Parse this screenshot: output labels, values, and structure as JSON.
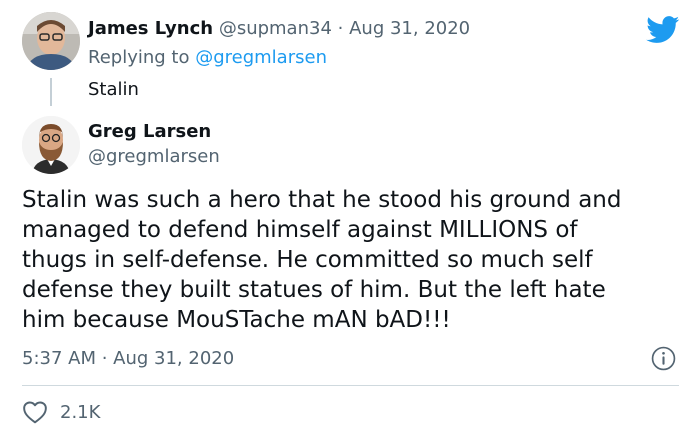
{
  "reply": {
    "display_name": "James Lynch",
    "handle": "@supman34",
    "separator": "·",
    "date": "Aug 31, 2020",
    "replying_label": "Replying to",
    "replying_to": "@gregmlarsen",
    "text": "Stalin"
  },
  "tweet": {
    "display_name": "Greg Larsen",
    "handle": "@gregmlarsen",
    "text": "Stalin was such a hero that he stood his ground and\nmanaged to defend himself against MILLIONS of\nthugs in self-defense. He committed so much self\ndefense they built statues of him. But the left hate\nhim because MouSTache mAN bAD!!!",
    "timestamp": "5:37 AM · Aug 31, 2020",
    "like_count": "2.1K"
  },
  "icons": {
    "brand": "twitter-bird-icon",
    "info": "info-icon",
    "like": "heart-icon"
  },
  "colors": {
    "accent": "#1d9bf0",
    "text": "#0f1419",
    "muted": "#536471",
    "divider": "#cfd9de"
  }
}
